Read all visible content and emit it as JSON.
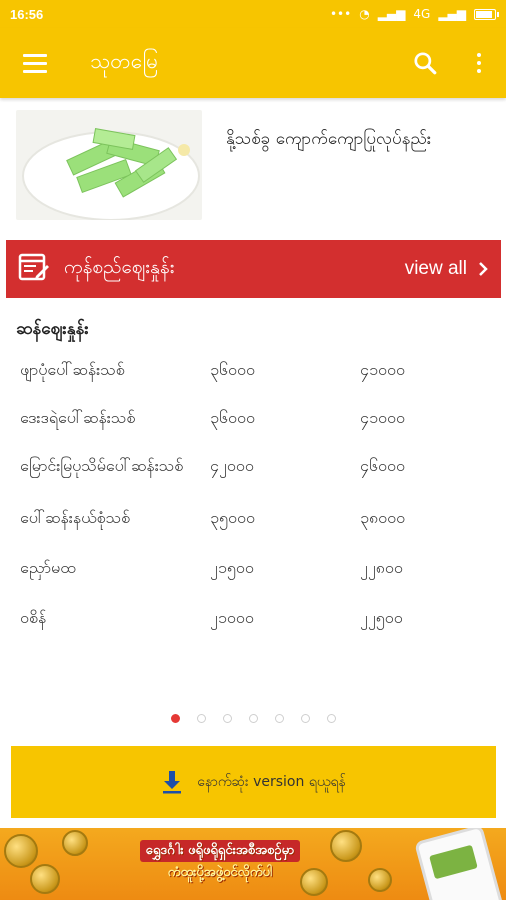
{
  "status_bar": {
    "time": "16:56",
    "network": "4G"
  },
  "app_bar": {
    "title": "သုတမြေ"
  },
  "article": {
    "title": "နို့သစ်ခွ ကျောက်ကျောပြုလုပ်နည်း",
    "thumbnail": "green jelly dessert image"
  },
  "price_banner": {
    "title": "ကုန်စည်ဈေးနှုန်း",
    "view_all": "view all"
  },
  "price_section": {
    "heading": "ဆန်ဈေးနှုန်း",
    "rows": [
      {
        "name": "ဖျာပုံပေါ်ဆန်းသစ်",
        "price1": "၃၆၀၀၀",
        "price2": "၄၁၀၀၀"
      },
      {
        "name": "ဒေးဒရဲပေါ်ဆန်းသစ်",
        "price1": "၃၆၀၀၀",
        "price2": "၄၁၀၀၀"
      },
      {
        "name": "မြောင်းမြပုသိမ်ပေါ်ဆန်းသစ်",
        "price1": "၄၂၀၀၀",
        "price2": "၄၆၀၀၀"
      },
      {
        "name": "ပေါ်ဆန်းနယ်စုံသစ်",
        "price1": "၃၅၀၀၀",
        "price2": "၃၈၀၀၀"
      },
      {
        "name": "ညှော်မထ",
        "price1": "၂၁၅၀၀",
        "price2": "၂၂၈၀၀"
      },
      {
        "name": "ဝစိန်",
        "price1": "၂၁၀၀၀",
        "price2": "၂၂၅၀၀"
      }
    ]
  },
  "pager": {
    "count": 7,
    "active": 0
  },
  "download_button": {
    "label": "နောက်ဆုံး version ရယူရန်"
  },
  "ad_banner": {
    "line1": "ရွှေဒင်္ဂါး ဖရိုဖရိုရှင်းအစီအစဉ်မှာ",
    "line2": "ကံထူးပို့အဖွဲ့ဝင်လိုက်ပါ"
  },
  "colors": {
    "primary": "#F7C500",
    "banner_red": "#D32F2F",
    "pager_active": "#E53935"
  },
  "icons": [
    "menu-icon",
    "search-icon",
    "more-vert-icon",
    "list-edit-icon",
    "chevron-right-icon",
    "download-icon"
  ]
}
